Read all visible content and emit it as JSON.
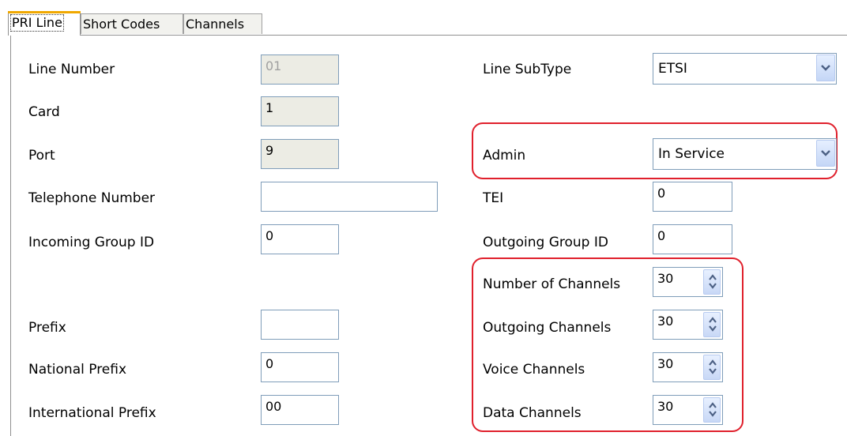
{
  "tabs": [
    "PRI Line",
    "Short Codes",
    "Channels"
  ],
  "left": {
    "line_number": {
      "label": "Line Number",
      "value": "01"
    },
    "card": {
      "label": "Card",
      "value": "1"
    },
    "port": {
      "label": "Port",
      "value": "9"
    },
    "telephone_number": {
      "label": "Telephone Number",
      "value": ""
    },
    "incoming_group_id": {
      "label": "Incoming Group ID",
      "value": "0"
    },
    "prefix": {
      "label": "Prefix",
      "value": ""
    },
    "national_prefix": {
      "label": "National Prefix",
      "value": "0"
    },
    "international_prefix": {
      "label": "International Prefix",
      "value": "00"
    }
  },
  "right": {
    "line_subtype": {
      "label": "Line SubType",
      "value": "ETSI"
    },
    "admin": {
      "label": "Admin",
      "value": "In Service"
    },
    "tei": {
      "label": "TEI",
      "value": "0"
    },
    "outgoing_group_id": {
      "label": "Outgoing Group ID",
      "value": "0"
    },
    "number_of_channels": {
      "label": "Number of Channels",
      "value": "30"
    },
    "outgoing_channels": {
      "label": "Outgoing Channels",
      "value": "30"
    },
    "voice_channels": {
      "label": "Voice Channels",
      "value": "30"
    },
    "data_channels": {
      "label": "Data Channels",
      "value": "30"
    }
  },
  "colors": {
    "highlight": "#e0202c",
    "active_tab_accent": "#f0a800",
    "readonly_bg": "#ecece4",
    "field_border": "#7f9db9"
  },
  "icons": {
    "dropdown": "chevron-down-icon",
    "spinner": "spinner-arrows-icon"
  }
}
